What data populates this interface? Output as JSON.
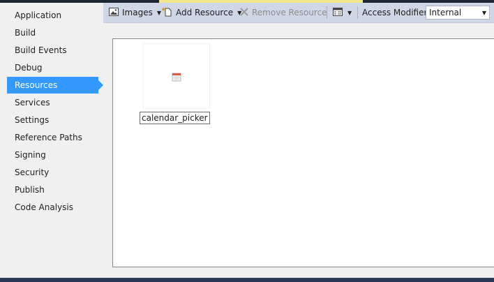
{
  "sidebar": {
    "items": [
      {
        "label": "Application"
      },
      {
        "label": "Build"
      },
      {
        "label": "Build Events"
      },
      {
        "label": "Debug"
      },
      {
        "label": "Resources",
        "active": true
      },
      {
        "label": "Services"
      },
      {
        "label": "Settings"
      },
      {
        "label": "Reference Paths"
      },
      {
        "label": "Signing"
      },
      {
        "label": "Security"
      },
      {
        "label": "Publish"
      },
      {
        "label": "Code Analysis"
      }
    ]
  },
  "toolbar": {
    "resource_type": "Images",
    "add_resource": "Add Resource",
    "remove_resource": "Remove Resource",
    "access_modifier_label": "Access Modifier:",
    "access_modifier_value": "Internal"
  },
  "resources": [
    {
      "name": "calendar_picker",
      "icon": "calendar-icon"
    }
  ],
  "colors": {
    "accent": "#3399ff",
    "toolbar_bg": "#cfd6e5",
    "icon_red": "#e05a4a"
  }
}
